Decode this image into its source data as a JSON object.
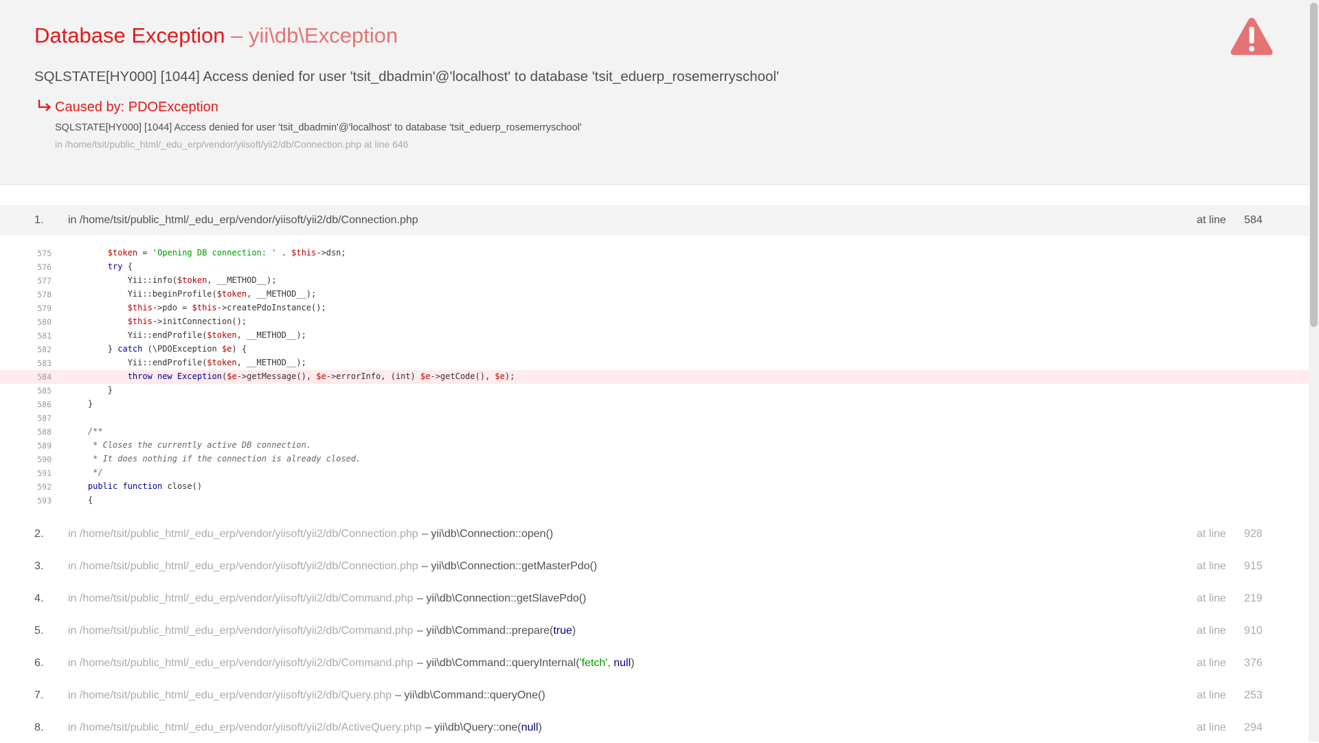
{
  "header": {
    "title": "Database Exception",
    "exception_class": "– yii\\db\\Exception",
    "message": "SQLSTATE[HY000] [1044] Access denied for user 'tsit_dbadmin'@'localhost' to database 'tsit_eduerp_rosemerryschool'",
    "caused_by": {
      "label": "Caused by: PDOException",
      "message": "SQLSTATE[HY000] [1044] Access denied for user 'tsit_dbadmin'@'localhost' to database 'tsit_eduerp_rosemerryschool'",
      "location": "in /home/tsit/public_html/_edu_erp/vendor/yiisoft/yii2/db/Connection.php at line 646"
    }
  },
  "at_line_label": "at line",
  "frames": [
    {
      "num": "1.",
      "file": "in /home/tsit/public_html/_edu_erp/vendor/yiisoft/yii2/db/Connection.php",
      "call": "",
      "line": "584"
    },
    {
      "num": "2.",
      "file": "in /home/tsit/public_html/_edu_erp/vendor/yiisoft/yii2/db/Connection.php",
      "call": "– yii\\db\\Connection::open()",
      "line": "928"
    },
    {
      "num": "3.",
      "file": "in /home/tsit/public_html/_edu_erp/vendor/yiisoft/yii2/db/Connection.php",
      "call": "– yii\\db\\Connection::getMasterPdo()",
      "line": "915"
    },
    {
      "num": "4.",
      "file": "in /home/tsit/public_html/_edu_erp/vendor/yiisoft/yii2/db/Command.php",
      "call": "– yii\\db\\Connection::getSlavePdo()",
      "line": "219"
    },
    {
      "num": "5.",
      "file": "in /home/tsit/public_html/_edu_erp/vendor/yiisoft/yii2/db/Command.php",
      "call": "– yii\\db\\Command::prepare(",
      "args": [
        {
          "text": "true",
          "type": "kw"
        }
      ],
      "call_end": ")",
      "line": "910"
    },
    {
      "num": "6.",
      "file": "in /home/tsit/public_html/_edu_erp/vendor/yiisoft/yii2/db/Command.php",
      "call": "– yii\\db\\Command::queryInternal(",
      "args": [
        {
          "text": "'fetch'",
          "type": "str"
        },
        {
          "text": ", ",
          "type": "plain"
        },
        {
          "text": "null",
          "type": "kw"
        }
      ],
      "call_end": ")",
      "line": "376"
    },
    {
      "num": "7.",
      "file": "in /home/tsit/public_html/_edu_erp/vendor/yiisoft/yii2/db/Query.php",
      "call": "– yii\\db\\Command::queryOne()",
      "line": "253"
    },
    {
      "num": "8.",
      "file": "in /home/tsit/public_html/_edu_erp/vendor/yiisoft/yii2/db/ActiveQuery.php",
      "call": "– yii\\db\\Query::one(",
      "args": [
        {
          "text": "null",
          "type": "kw"
        }
      ],
      "call_end": ")",
      "line": "294"
    }
  ],
  "code": {
    "error_line": "584",
    "lines": [
      {
        "n": "575",
        "tokens": [
          [
            "p",
            "        "
          ],
          [
            "v",
            "$token"
          ],
          [
            "p",
            " = "
          ],
          [
            "s",
            "'Opening DB connection: '"
          ],
          [
            "p",
            " . "
          ],
          [
            "v",
            "$this"
          ],
          [
            "p",
            "->dsn;"
          ]
        ]
      },
      {
        "n": "576",
        "tokens": [
          [
            "p",
            "        "
          ],
          [
            "k",
            "try"
          ],
          [
            "p",
            " {"
          ]
        ]
      },
      {
        "n": "577",
        "tokens": [
          [
            "p",
            "            Yii::info("
          ],
          [
            "v",
            "$token"
          ],
          [
            "p",
            ", __METHOD__);"
          ]
        ]
      },
      {
        "n": "578",
        "tokens": [
          [
            "p",
            "            Yii::beginProfile("
          ],
          [
            "v",
            "$token"
          ],
          [
            "p",
            ", __METHOD__);"
          ]
        ]
      },
      {
        "n": "579",
        "tokens": [
          [
            "p",
            "            "
          ],
          [
            "v",
            "$this"
          ],
          [
            "p",
            "->pdo = "
          ],
          [
            "v",
            "$this"
          ],
          [
            "p",
            "->createPdoInstance();"
          ]
        ]
      },
      {
        "n": "580",
        "tokens": [
          [
            "p",
            "            "
          ],
          [
            "v",
            "$this"
          ],
          [
            "p",
            "->initConnection();"
          ]
        ]
      },
      {
        "n": "581",
        "tokens": [
          [
            "p",
            "            Yii::endProfile("
          ],
          [
            "v",
            "$token"
          ],
          [
            "p",
            ", __METHOD__);"
          ]
        ]
      },
      {
        "n": "582",
        "tokens": [
          [
            "p",
            "        } "
          ],
          [
            "k",
            "catch"
          ],
          [
            "p",
            " (\\PDOException "
          ],
          [
            "v",
            "$e"
          ],
          [
            "p",
            ") {"
          ]
        ]
      },
      {
        "n": "583",
        "tokens": [
          [
            "p",
            "            Yii::endProfile("
          ],
          [
            "v",
            "$token"
          ],
          [
            "p",
            ", __METHOD__);"
          ]
        ]
      },
      {
        "n": "584",
        "tokens": [
          [
            "p",
            "            "
          ],
          [
            "k",
            "throw new"
          ],
          [
            "p",
            " "
          ],
          [
            "k",
            "Exception"
          ],
          [
            "p",
            "("
          ],
          [
            "v",
            "$e"
          ],
          [
            "p",
            "->getMessage(), "
          ],
          [
            "v",
            "$e"
          ],
          [
            "p",
            "->errorInfo, (int) "
          ],
          [
            "v",
            "$e"
          ],
          [
            "p",
            "->getCode(), "
          ],
          [
            "v",
            "$e"
          ],
          [
            "p",
            ");"
          ]
        ]
      },
      {
        "n": "585",
        "tokens": [
          [
            "p",
            "        }"
          ]
        ]
      },
      {
        "n": "586",
        "tokens": [
          [
            "p",
            "    }"
          ]
        ]
      },
      {
        "n": "587",
        "tokens": []
      },
      {
        "n": "588",
        "tokens": [
          [
            "p",
            "    "
          ],
          [
            "c",
            "/**"
          ]
        ]
      },
      {
        "n": "589",
        "tokens": [
          [
            "p",
            "    "
          ],
          [
            "c",
            " * Closes the currently active DB connection."
          ]
        ]
      },
      {
        "n": "590",
        "tokens": [
          [
            "p",
            "    "
          ],
          [
            "c",
            " * It does nothing if the connection is already closed."
          ]
        ]
      },
      {
        "n": "591",
        "tokens": [
          [
            "p",
            "    "
          ],
          [
            "c",
            " */"
          ]
        ]
      },
      {
        "n": "592",
        "tokens": [
          [
            "p",
            "    "
          ],
          [
            "k",
            "public function"
          ],
          [
            "p",
            " close()"
          ]
        ]
      },
      {
        "n": "593",
        "tokens": [
          [
            "p",
            "    {"
          ]
        ]
      }
    ]
  },
  "colors": {
    "title_red": "#e51717",
    "exception_class": "#e57373",
    "header_bg": "#f3f3f3",
    "error_line_bg": "#ffebeb",
    "warning_icon": "#e57373"
  },
  "icons": {
    "warning": "warning-triangle-icon",
    "caused_by": "arrow-down-right-icon"
  }
}
